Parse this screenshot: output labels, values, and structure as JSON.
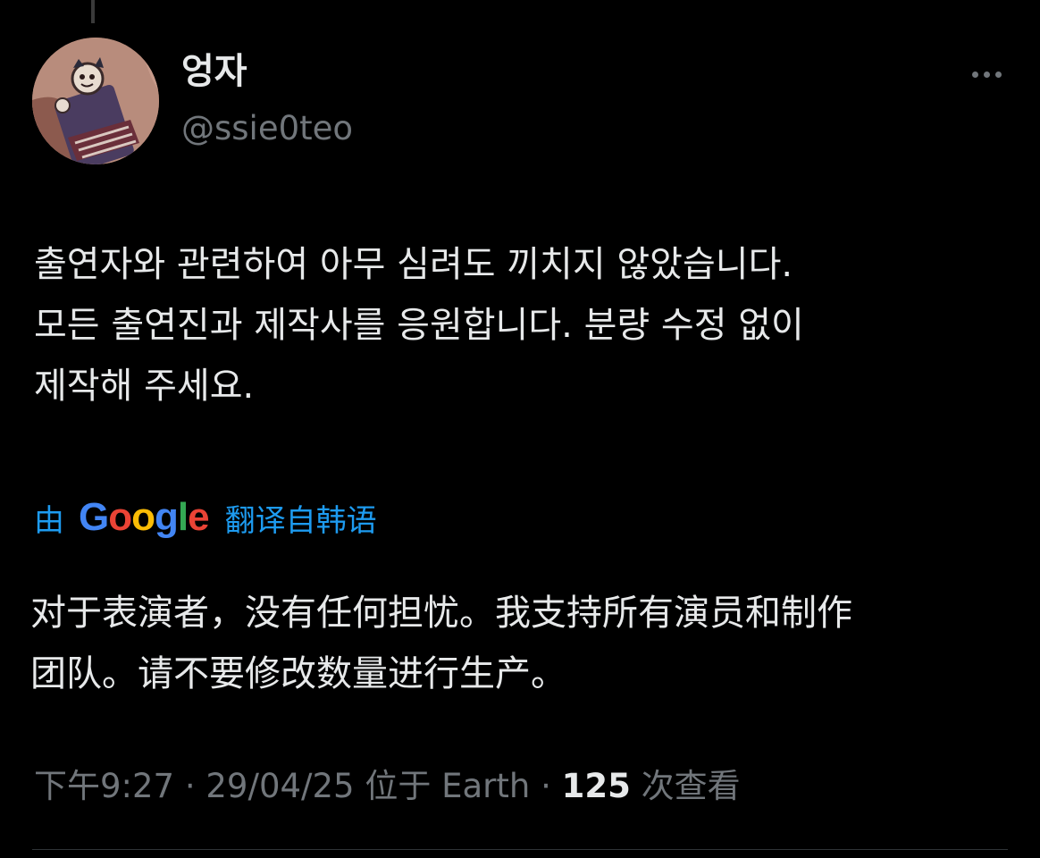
{
  "tweet": {
    "author": {
      "display_name": "엉자",
      "handle": "@ssie0teo"
    },
    "more_icon": "more-horizontal-icon",
    "text_lines": [
      "출연자와 관련하여 아무 심려도 끼치지 않았습니다.",
      "모든 출연진과 제작사를 응원합니다. 분량 수정 없이",
      "제작해 주세요."
    ],
    "translation": {
      "prefix": "由",
      "logo_letters": [
        "G",
        "o",
        "o",
        "g",
        "l",
        "e"
      ],
      "logo_colors": [
        "#4285F4",
        "#EA4335",
        "#FBBC05",
        "#4285F4",
        "#34A853",
        "#EA4335"
      ],
      "suffix": "翻译自韩语",
      "text_lines": [
        "对于表演者，没有任何担忧。我支持所有演员和制作",
        "团队。请不要修改数量进行生产。"
      ]
    },
    "meta": {
      "time": "下午9:27",
      "separator": " · ",
      "date": "29/04/25",
      "location_prefix": " 位于 ",
      "location": "Earth",
      "views_count": "125",
      "views_label": " 次查看"
    }
  },
  "colors": {
    "background": "#000000",
    "primary_text": "#e7e9ea",
    "secondary_text": "#71767b",
    "link_blue": "#1d9bf0",
    "divider": "#2f3336"
  }
}
